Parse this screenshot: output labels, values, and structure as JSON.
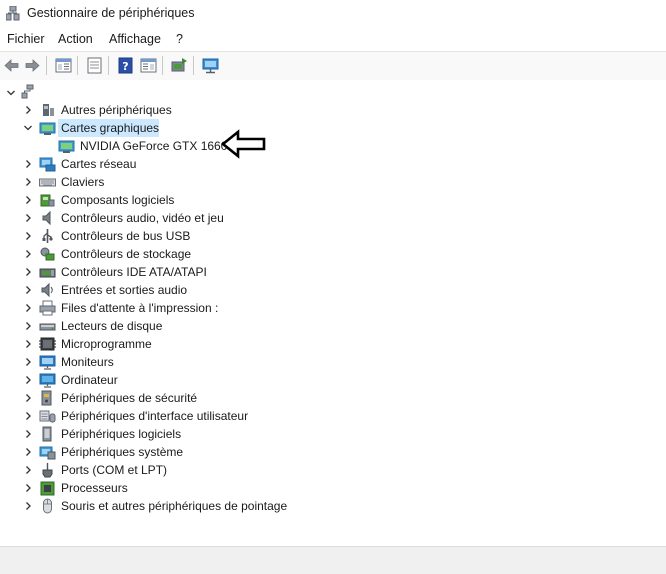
{
  "window": {
    "title": "Gestionnaire de périphériques"
  },
  "menu": [
    "Fichier",
    "Action",
    "Affichage",
    "?"
  ],
  "toolbar": {
    "buttons": [
      "back-icon",
      "forward-icon",
      "show-hide-console-tree-icon",
      "properties-icon",
      "help-icon",
      "action-pane-icon",
      "update-driver-icon",
      "monitor-scan-icon"
    ]
  },
  "tree": {
    "root": {
      "expanded": true,
      "icon": "computer-icon"
    },
    "categories": [
      {
        "label": "Autres périphériques",
        "icon": "unknown-device-icon",
        "expanded": false
      },
      {
        "label": "Cartes graphiques",
        "icon": "display-adapter-icon",
        "expanded": true,
        "selected": true,
        "children": [
          {
            "label": "NVIDIA GeForce GTX 1660",
            "icon": "display-adapter-icon"
          }
        ]
      },
      {
        "label": "Cartes réseau",
        "icon": "network-adapter-icon",
        "expanded": false
      },
      {
        "label": "Claviers",
        "icon": "keyboard-icon",
        "expanded": false
      },
      {
        "label": "Composants logiciels",
        "icon": "software-component-icon",
        "expanded": false
      },
      {
        "label": "Contrôleurs audio, vidéo et jeu",
        "icon": "speaker-icon",
        "expanded": false
      },
      {
        "label": "Contrôleurs de bus USB",
        "icon": "usb-icon",
        "expanded": false
      },
      {
        "label": "Contrôleurs de stockage",
        "icon": "storage-controller-icon",
        "expanded": false
      },
      {
        "label": "Contrôleurs IDE ATA/ATAPI",
        "icon": "ide-controller-icon",
        "expanded": false
      },
      {
        "label": "Entrées et sorties audio",
        "icon": "audio-io-icon",
        "expanded": false
      },
      {
        "label": "Files d'attente à l'impression :",
        "icon": "printer-icon",
        "expanded": false
      },
      {
        "label": "Lecteurs de disque",
        "icon": "disk-drive-icon",
        "expanded": false
      },
      {
        "label": "Microprogramme",
        "icon": "firmware-icon",
        "expanded": false
      },
      {
        "label": "Moniteurs",
        "icon": "monitor-icon",
        "expanded": false
      },
      {
        "label": "Ordinateur",
        "icon": "computer-icon",
        "expanded": false
      },
      {
        "label": "Périphériques de sécurité",
        "icon": "security-device-icon",
        "expanded": false
      },
      {
        "label": "Périphériques d'interface utilisateur",
        "icon": "hid-icon",
        "expanded": false
      },
      {
        "label": "Périphériques logiciels",
        "icon": "software-device-icon",
        "expanded": false
      },
      {
        "label": "Périphériques système",
        "icon": "system-device-icon",
        "expanded": false
      },
      {
        "label": "Ports (COM et LPT)",
        "icon": "port-icon",
        "expanded": false
      },
      {
        "label": "Processeurs",
        "icon": "processor-icon",
        "expanded": false
      },
      {
        "label": "Souris et autres périphériques de pointage",
        "icon": "mouse-icon",
        "expanded": false
      }
    ]
  },
  "annotation": {
    "icon": "left-arrow-annotation-icon"
  }
}
